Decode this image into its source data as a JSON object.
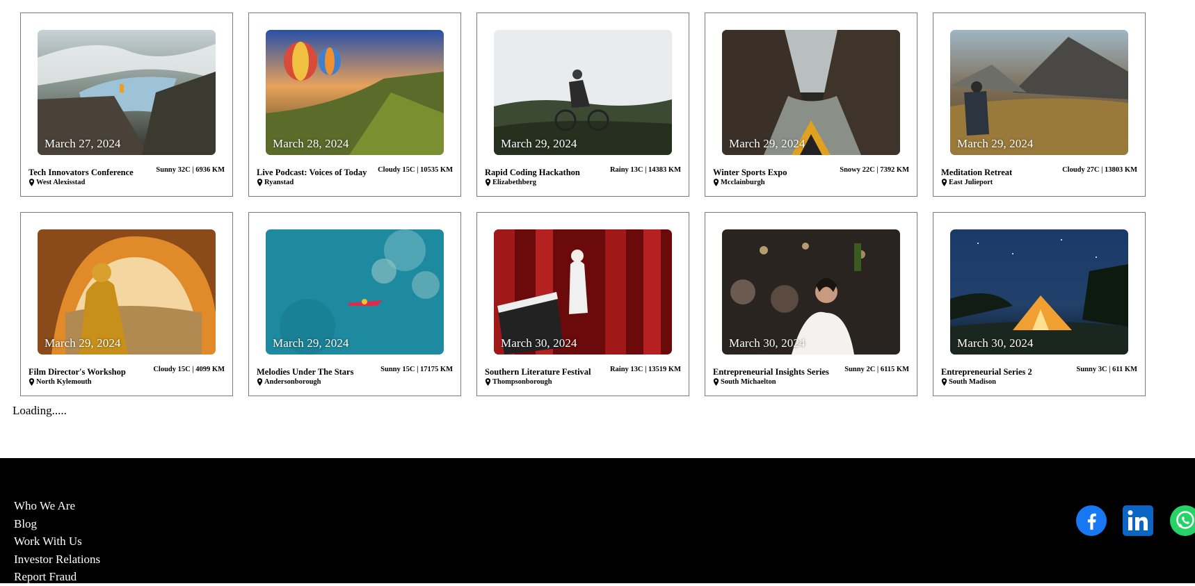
{
  "events": [
    {
      "date": "March 27, 2024",
      "title": "Tech Innovators Conference",
      "weather": "Sunny 32C | 6936 KM",
      "location": "West Alexisstad"
    },
    {
      "date": "March 28, 2024",
      "title": "Live Podcast: Voices of Today",
      "weather": "Cloudy 15C | 10535 KM",
      "location": "Ryanstad"
    },
    {
      "date": "March 29, 2024",
      "title": "Rapid Coding Hackathon",
      "weather": "Rainy 13C | 14383 KM",
      "location": "Elizabethberg"
    },
    {
      "date": "March 29, 2024",
      "title": "Winter Sports Expo",
      "weather": "Snowy 22C | 7392 KM",
      "location": "Mcclainburgh"
    },
    {
      "date": "March 29, 2024",
      "title": "Meditation Retreat",
      "weather": "Cloudy 27C | 13803 KM",
      "location": "East Julieport"
    },
    {
      "date": "March 29, 2024",
      "title": "Film Director's Workshop",
      "weather": "Cloudy 15C | 4099 KM",
      "location": "North Kylemouth"
    },
    {
      "date": "March 29, 2024",
      "title": "Melodies Under The Stars",
      "weather": "Sunny 15C | 17175 KM",
      "location": "Andersonborough"
    },
    {
      "date": "March 30, 2024",
      "title": "Southern Literature Festival",
      "weather": "Rainy 13C | 13519 KM",
      "location": "Thompsonborough"
    },
    {
      "date": "March 30, 2024",
      "title": "Entrepreneurial Insights Series",
      "weather": "Sunny 2C | 6115 KM",
      "location": "South Michaelton"
    },
    {
      "date": "March 30, 2024",
      "title": "Entrepreneurial Series 2",
      "weather": "Sunny 3C | 611 KM",
      "location": "South Madison"
    }
  ],
  "loading_text": "Loading.....",
  "footer": {
    "links": [
      "Who We Are",
      "Blog",
      "Work With Us",
      "Investor Relations",
      "Report Fraud"
    ],
    "social": [
      "facebook-icon",
      "linkedin-icon",
      "whatsapp-icon"
    ],
    "colors": {
      "facebook": "#1877f2",
      "linkedin": "#0a66c2",
      "whatsapp": "#25d366",
      "background": "#000000"
    }
  }
}
